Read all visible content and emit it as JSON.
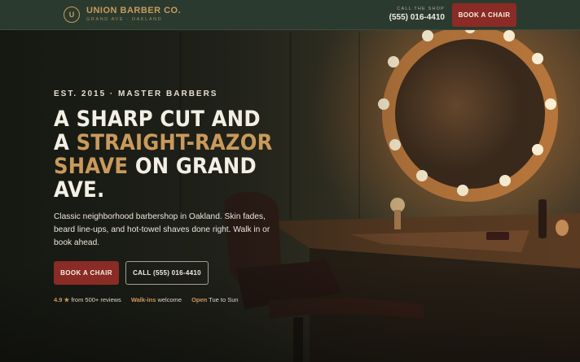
{
  "header": {
    "logo_letter": "U",
    "brand_name": "UNION BARBER CO.",
    "brand_sub": "GRAND AVE · OAKLAND",
    "call_label": "CALL THE SHOP",
    "call_number": "(555) 016-4410",
    "book_label": "BOOK A CHAIR"
  },
  "hero": {
    "eyebrow": "EST. 2015 · MASTER BARBERS",
    "headline_1": "A SHARP CUT AND",
    "headline_2a": "A ",
    "headline_2b": "STRAIGHT-RAZOR",
    "headline_3a": "SHAVE",
    "headline_3b": " ON GRAND",
    "headline_4": "AVE.",
    "lead": "Classic neighborhood barbershop in Oakland. Skin fades, beard line-ups, and hot-towel shaves done right. Walk in or book ahead.",
    "cta_book": "BOOK A CHAIR",
    "cta_call": "CALL (555) 016-4410"
  },
  "trust": {
    "rating": "4.9 ★",
    "rating_text": " from 500+ reviews",
    "walkins": "Walk-ins",
    "walkins_text": " welcome",
    "open": "Open",
    "open_text": " Tue to Sun"
  },
  "colors": {
    "accent": "#c99a5b",
    "brand_red": "#8a2b25",
    "header_bg": "#2b3a2e"
  },
  "icons": [
    "logo-monogram-icon",
    "star-icon"
  ]
}
